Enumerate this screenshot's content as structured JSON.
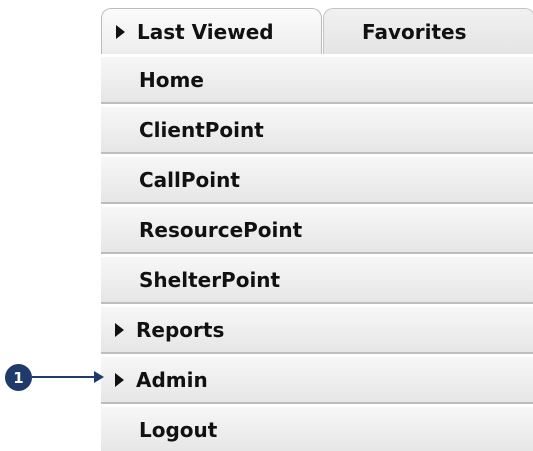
{
  "tabs": [
    {
      "label": "Last Viewed",
      "expanded_icon": "caret-right-icon",
      "active": true
    },
    {
      "label": "Favorites",
      "active": false
    }
  ],
  "menu": {
    "items": [
      {
        "label": "Home",
        "has_submenu": false
      },
      {
        "label": "ClientPoint",
        "has_submenu": false
      },
      {
        "label": "CallPoint",
        "has_submenu": false
      },
      {
        "label": "ResourcePoint",
        "has_submenu": false
      },
      {
        "label": "ShelterPoint",
        "has_submenu": false
      },
      {
        "label": "Reports",
        "has_submenu": true
      },
      {
        "label": "Admin",
        "has_submenu": true
      },
      {
        "label": "Logout",
        "has_submenu": false
      }
    ]
  },
  "callout": {
    "number": "1",
    "color": "#1f3a6b",
    "target": "Admin"
  },
  "colors": {
    "menu_background": "#ececec",
    "menu_separator": "#bdbdbd",
    "text": "#111111"
  }
}
